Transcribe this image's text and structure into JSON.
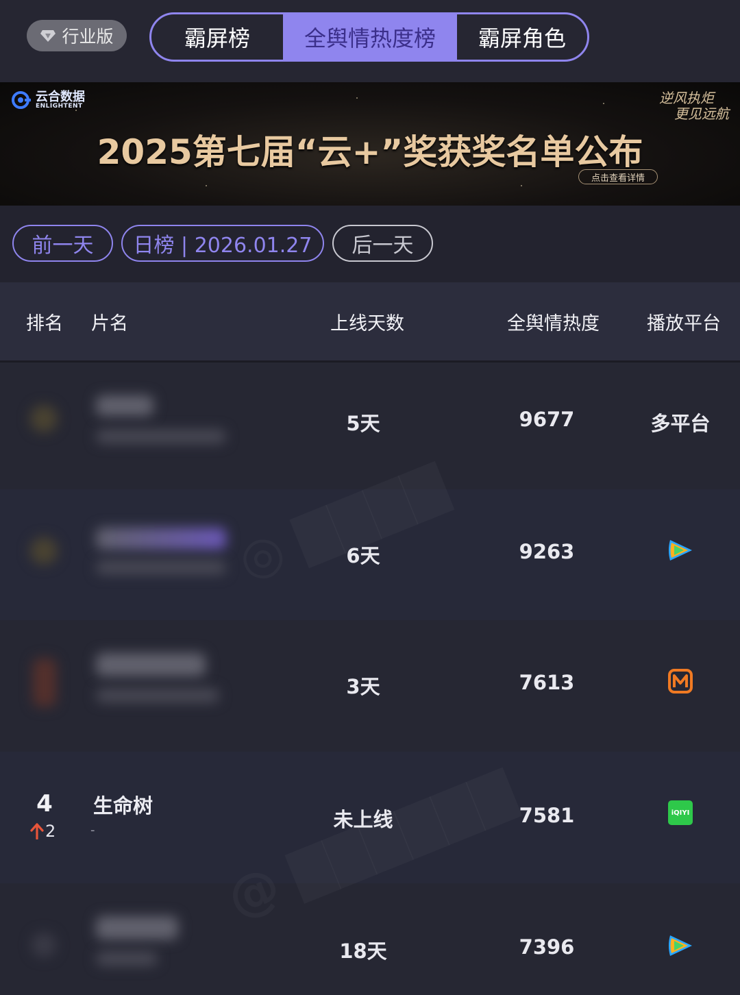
{
  "header": {
    "industry_badge": "行业版",
    "tabs": [
      {
        "label": "霸屏榜",
        "active": false
      },
      {
        "label": "全舆情热度榜",
        "active": true
      },
      {
        "label": "霸屏角色",
        "active": false
      }
    ]
  },
  "banner": {
    "brand_cn": "云合数据",
    "brand_en": "ENLIGHTENT",
    "title": "2025第七届“云+”奖获奖名单公布",
    "cta": "点击查看详情",
    "slogan_line1": "逆风执炬",
    "slogan_line2": "更见远航"
  },
  "date_nav": {
    "prev": "前一天",
    "current": "日榜 | 2026.01.27",
    "next": "后一天"
  },
  "table": {
    "columns": [
      "排名",
      "片名",
      "上线天数",
      "全舆情热度",
      "播放平台"
    ],
    "rows": [
      {
        "rank": "",
        "rank_change": "",
        "title": "",
        "subtitle": "",
        "days": "5天",
        "heat": "9677",
        "platform": "多平台",
        "platform_icon": ""
      },
      {
        "rank": "",
        "rank_change": "",
        "title": "",
        "subtitle": "",
        "days": "6天",
        "heat": "9263",
        "platform": "",
        "platform_icon": "tencent-video-icon"
      },
      {
        "rank": "",
        "rank_change": "",
        "title": "",
        "subtitle": "",
        "days": "3天",
        "heat": "7613",
        "platform": "",
        "platform_icon": "mango-tv-icon"
      },
      {
        "rank": "4",
        "rank_change": "2",
        "title": "生命树",
        "subtitle": "-",
        "days": "未上线",
        "heat": "7581",
        "platform": "",
        "platform_icon": "iqiyi-icon",
        "platform_icon_text": "iQIYI"
      },
      {
        "rank": "",
        "rank_change": "",
        "title": "",
        "subtitle": "",
        "days": "18天",
        "heat": "7396",
        "platform": "",
        "platform_icon": "tencent-video-icon"
      }
    ]
  },
  "colors": {
    "accent": "#8f85ee",
    "background": "#23232f",
    "header_row": "#2c2d3d",
    "rank_up": "#e8553a",
    "iqiyi": "#2ec84a",
    "mango": "#f07a23"
  }
}
